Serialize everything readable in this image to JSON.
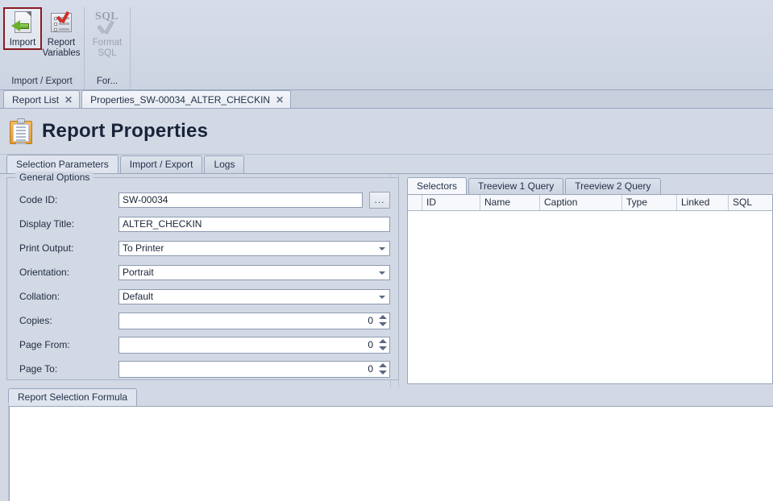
{
  "ribbon": {
    "groups": [
      {
        "title": "Import / Export",
        "buttons": [
          {
            "label": "Import",
            "icon": "import-page-arrow-icon",
            "state": "selected"
          },
          {
            "label": "Report\nVariables",
            "label_line1": "Report",
            "label_line2": "Variables",
            "icon": "report-variables-checklist-icon",
            "state": "normal"
          }
        ]
      },
      {
        "title": "For...",
        "buttons": [
          {
            "label_line1": "Format",
            "label_line2": "SQL",
            "icon": "format-sql-check-icon",
            "state": "disabled"
          }
        ]
      }
    ]
  },
  "document_tabs": [
    {
      "label": "Report List",
      "active": false,
      "close": "✕"
    },
    {
      "label": "Properties_SW-00034_ALTER_CHECKIN",
      "active": true,
      "close": "✕"
    }
  ],
  "page": {
    "icon": "clipboard-icon",
    "title": "Report Properties"
  },
  "sub_tabs": [
    {
      "label": "Selection Parameters",
      "active": true
    },
    {
      "label": "Import / Export",
      "active": false
    },
    {
      "label": "Logs",
      "active": false
    }
  ],
  "general_options": {
    "legend": "General Options",
    "fields": [
      {
        "label": "Code ID:",
        "type": "text",
        "value": "SW-00034",
        "browse_label": "..."
      },
      {
        "label": "Display Title:",
        "type": "text",
        "value": "ALTER_CHECKIN"
      },
      {
        "label": "Print Output:",
        "type": "combo",
        "value": "To Printer"
      },
      {
        "label": "Orientation:",
        "type": "combo",
        "value": "Portrait"
      },
      {
        "label": "Collation:",
        "type": "combo",
        "value": "Default"
      },
      {
        "label": "Copies:",
        "type": "spin",
        "value": "0"
      },
      {
        "label": "Page From:",
        "type": "spin",
        "value": "0"
      },
      {
        "label": "Page To:",
        "type": "spin",
        "value": "0"
      }
    ]
  },
  "right_panel": {
    "tabs": [
      {
        "label": "Selectors",
        "active": true
      },
      {
        "label": "Treeview 1 Query",
        "active": false
      },
      {
        "label": "Treeview 2 Query",
        "active": false
      }
    ],
    "grid": {
      "columns": [
        "",
        "ID",
        "Name",
        "Caption",
        "Type",
        "Linked",
        "SQL"
      ],
      "rows": []
    }
  },
  "bottom_panel": {
    "tabs": [
      {
        "label": "Report Selection Formula",
        "active": true
      }
    ],
    "formula_value": ""
  },
  "colors": {
    "window_background": "#d2d9e5",
    "selection_border": "#8c1a21",
    "accent_green": "#69b12c",
    "accent_red": "#cf2f24",
    "accent_orange": "#e09a32",
    "text": "#1f2a3d",
    "disabled_text": "#9aa2b0",
    "field_background": "#ffffff",
    "border": "#98a5bb"
  }
}
